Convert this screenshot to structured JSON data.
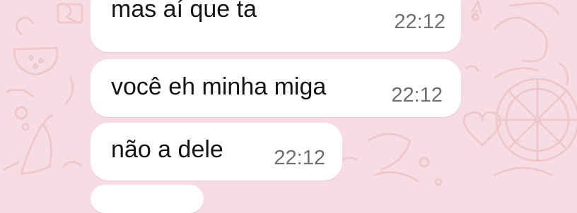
{
  "theme": {
    "wallpaper_color": "#f7dde3",
    "doodle_color": "#efc7d0",
    "bubble_color": "#ffffff",
    "text_color": "#141414",
    "time_color": "#6f6f6f"
  },
  "messages": [
    {
      "text": "mas aí que ta",
      "time": "22:12"
    },
    {
      "text": "você eh minha miga",
      "time": "22:12"
    },
    {
      "text": "não a dele",
      "time": "22:12"
    }
  ]
}
